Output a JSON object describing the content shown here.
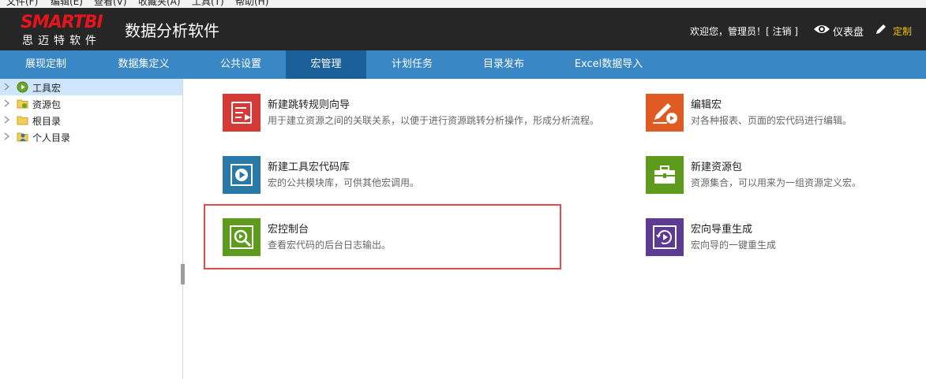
{
  "menubar": {
    "items": [
      "文件(F)",
      "编辑(E)",
      "查看(V)",
      "收藏夹(A)",
      "工具(T)",
      "帮助(H)"
    ]
  },
  "header": {
    "logo_text": "SMARTBI",
    "logo_sub": "思迈特软件",
    "app_title": "数据分析软件",
    "welcome": "欢迎您，管理员！[ 注销 ]",
    "dashboard_label": "仪表盘",
    "custom_label": "定制"
  },
  "nav": {
    "tabs": [
      {
        "label": "展现定制"
      },
      {
        "label": "数据集定义"
      },
      {
        "label": "公共设置"
      },
      {
        "label": "宏管理",
        "active": true
      },
      {
        "label": "计划任务"
      },
      {
        "label": "目录发布"
      },
      {
        "label": "Excel数据导入"
      }
    ]
  },
  "tree": {
    "items": [
      {
        "label": "工具宏",
        "icon": "tool-macro-icon",
        "selected": true
      },
      {
        "label": "资源包",
        "icon": "resource-pack-icon"
      },
      {
        "label": "根目录",
        "icon": "folder-icon"
      },
      {
        "label": "个人目录",
        "icon": "personal-folder-icon"
      }
    ]
  },
  "cards": [
    {
      "title": "新建跳转规则向导",
      "desc": "用于建立资源之间的关联关系，以便于进行资源跳转分析操作，形成分析流程。",
      "color": "#d63a37",
      "icon": "jump-rule-icon"
    },
    {
      "title": "编辑宏",
      "desc": "对各种报表、页面的宏代码进行编辑。",
      "color": "#e05a23",
      "icon": "edit-macro-icon"
    },
    {
      "title": "新建工具宏代码库",
      "desc": "宏的公共模块库，可供其他宏调用。",
      "color": "#2879a6",
      "icon": "macro-library-icon"
    },
    {
      "title": "新建资源包",
      "desc": "资源集合，可以用来为一组资源定义宏。",
      "color": "#5e9a1c",
      "icon": "toolbox-icon"
    },
    {
      "title": "宏控制台",
      "desc": "查看宏代码的后台日志输出。",
      "color": "#5e9a1c",
      "icon": "console-icon"
    },
    {
      "title": "宏向导重生成",
      "desc": "宏向导的一键重生成",
      "color": "#5e3a92",
      "icon": "regenerate-icon"
    }
  ]
}
